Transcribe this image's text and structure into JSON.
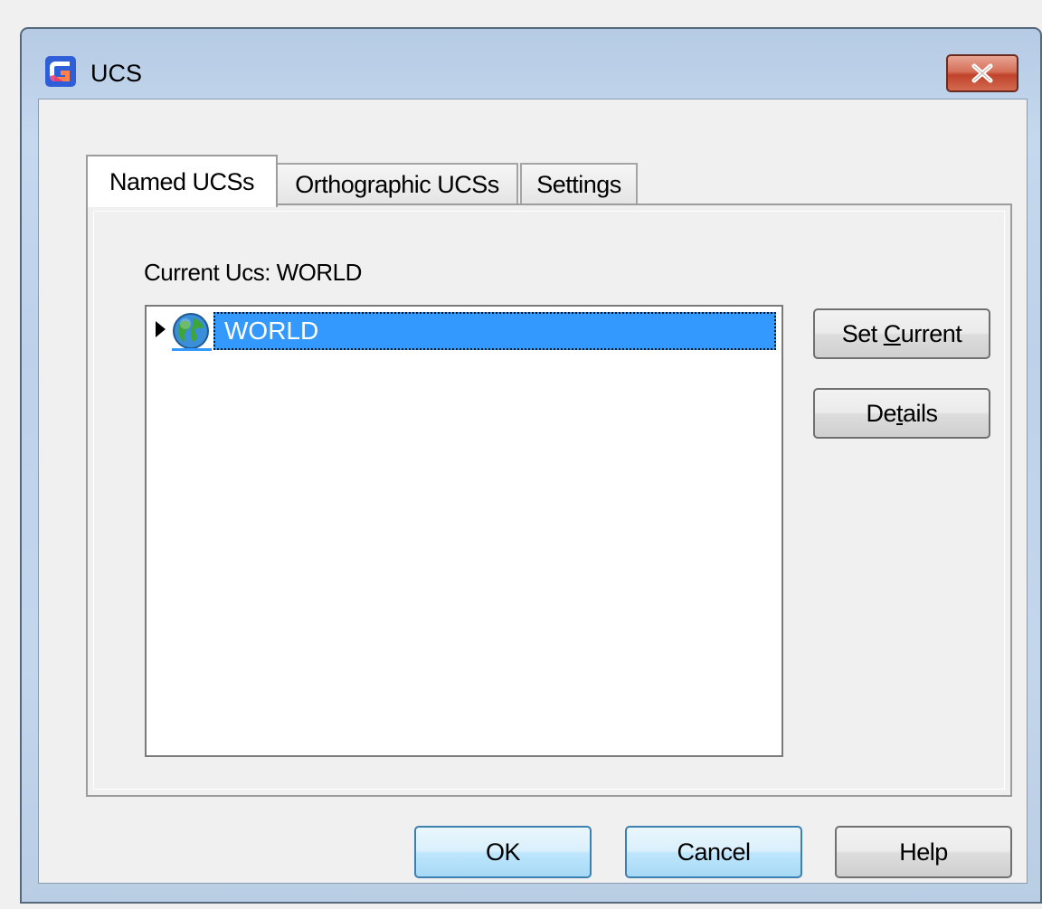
{
  "window": {
    "title": "UCS",
    "close_label": "✕"
  },
  "tabs": [
    {
      "label": "Named UCSs",
      "active": true
    },
    {
      "label": "Orthographic UCSs",
      "active": false
    },
    {
      "label": "Settings",
      "active": false
    }
  ],
  "named_ucs": {
    "current_label": "Current Ucs: WORLD",
    "tree_items": [
      {
        "label": "WORLD",
        "icon": "globe-icon",
        "selected": true,
        "expander": "collapsed"
      }
    ],
    "set_current_pre": "Set ",
    "set_current_key": "C",
    "set_current_post": "urrent",
    "details_pre": "De",
    "details_key": "t",
    "details_post": "ails"
  },
  "footer": {
    "ok_label": "OK",
    "cancel_label": "Cancel",
    "help_label": "Help"
  },
  "colors": {
    "selection": "#3399ff",
    "close_button": "#c7402a",
    "title_gradient": "#b6cbe4"
  }
}
